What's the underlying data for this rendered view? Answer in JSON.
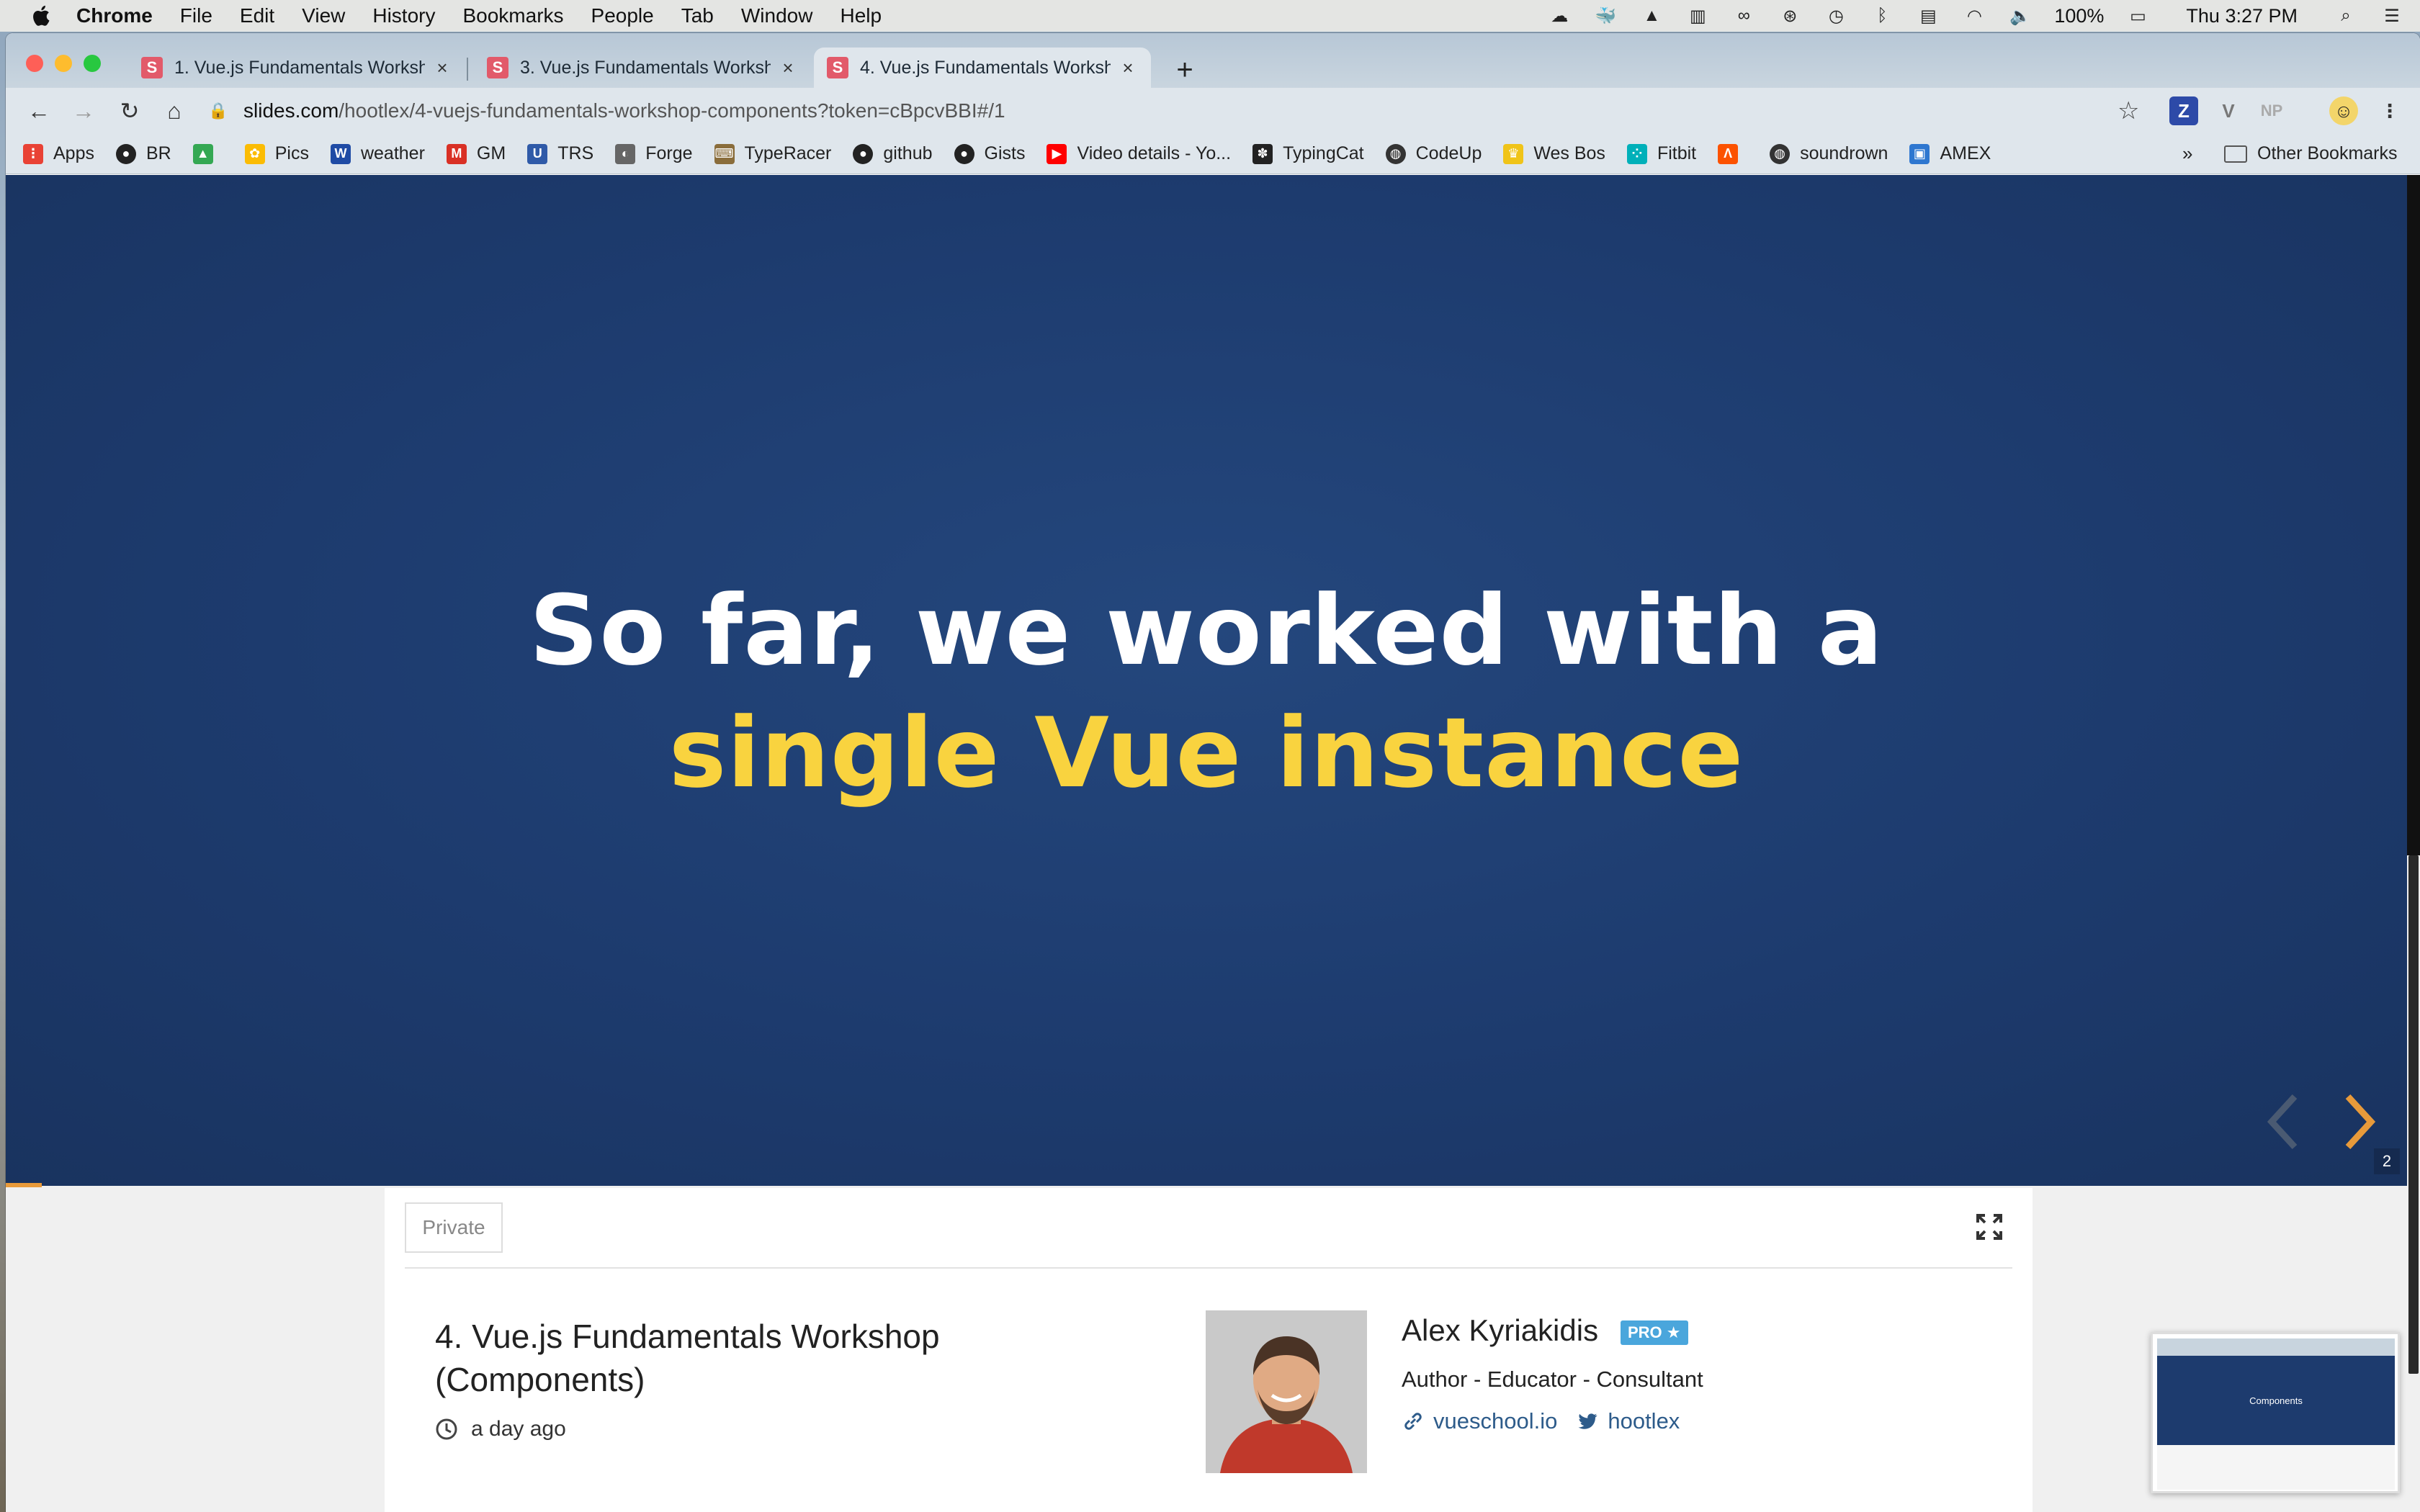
{
  "menubar": {
    "app_name": "Chrome",
    "menus": [
      "File",
      "Edit",
      "View",
      "History",
      "Bookmarks",
      "People",
      "Tab",
      "Window",
      "Help"
    ],
    "battery": "100%",
    "clock": "Thu 3:27 PM"
  },
  "tabs": [
    {
      "title": "1. Vue.js Fundamentals Worksh",
      "favicon": "S"
    },
    {
      "title": "3. Vue.js Fundamentals Worksh",
      "favicon": "S"
    },
    {
      "title": "4. Vue.js Fundamentals Worksh",
      "favicon": "S",
      "active": true
    }
  ],
  "omnibox": {
    "host": "slides.com",
    "path": "/hootlex/4-vuejs-fundamentals-workshop-components?token=cBpcvBBI#/1"
  },
  "extensions": [
    "Z",
    "V",
    "NP"
  ],
  "bookmarks": [
    {
      "label": "Apps",
      "icon": "apps-grid-icon",
      "color": "#e94235"
    },
    {
      "label": "BR",
      "icon": "github-icon",
      "color": "#222222"
    },
    {
      "label": "",
      "icon": "google-drive-icon",
      "color": "#34a853"
    },
    {
      "label": "Pics",
      "icon": "google-photos-icon",
      "color": "#fbbc04"
    },
    {
      "label": "weather",
      "icon": "weather-channel-icon",
      "color": "#1f4ba5"
    },
    {
      "label": "GM",
      "icon": "gmail-icon",
      "color": "#d93025"
    },
    {
      "label": "TRS",
      "icon": "trs-icon",
      "color": "#2f5aa8"
    },
    {
      "label": "Forge",
      "icon": "forge-icon",
      "color": "#666666"
    },
    {
      "label": "TypeRacer",
      "icon": "typeracer-icon",
      "color": "#8a6d3b"
    },
    {
      "label": "github",
      "icon": "github-icon",
      "color": "#222222"
    },
    {
      "label": "Gists",
      "icon": "github-icon",
      "color": "#222222"
    },
    {
      "label": "Video details - Yo...",
      "icon": "youtube-icon",
      "color": "#ff0000"
    },
    {
      "label": "TypingCat",
      "icon": "paw-icon",
      "color": "#222222"
    },
    {
      "label": "CodeUp",
      "icon": "globe-icon",
      "color": "#333333"
    },
    {
      "label": "Wes Bos",
      "icon": "crown-icon",
      "color": "#f0c419"
    },
    {
      "label": "Fitbit",
      "icon": "fitbit-icon",
      "color": "#00b0b9"
    },
    {
      "label": "",
      "icon": "strava-icon",
      "color": "#fc5200"
    },
    {
      "label": "soundrown",
      "icon": "globe-icon",
      "color": "#333333"
    },
    {
      "label": "AMEX",
      "icon": "amex-icon",
      "color": "#2e77d0"
    }
  ],
  "bookmarks_more": "»",
  "bookmarks_other": "Other Bookmarks",
  "slide": {
    "line1": "So far, we worked with a",
    "line2": "single Vue instance",
    "slide_number": "2",
    "title_color": "#ffffff",
    "highlight_color": "#f9d33f",
    "background": "#1d3b6e"
  },
  "deck": {
    "visibility": "Private",
    "title": "4. Vue.js Fundamentals Workshop (Components)",
    "updated": "a day ago"
  },
  "author": {
    "name": "Alex Kyriakidis",
    "badge": "PRO ★",
    "bio": "Author - Educator - Consultant",
    "website": "vueschool.io",
    "twitter": "hootlex"
  },
  "thumbnail": {
    "label": "Components"
  }
}
